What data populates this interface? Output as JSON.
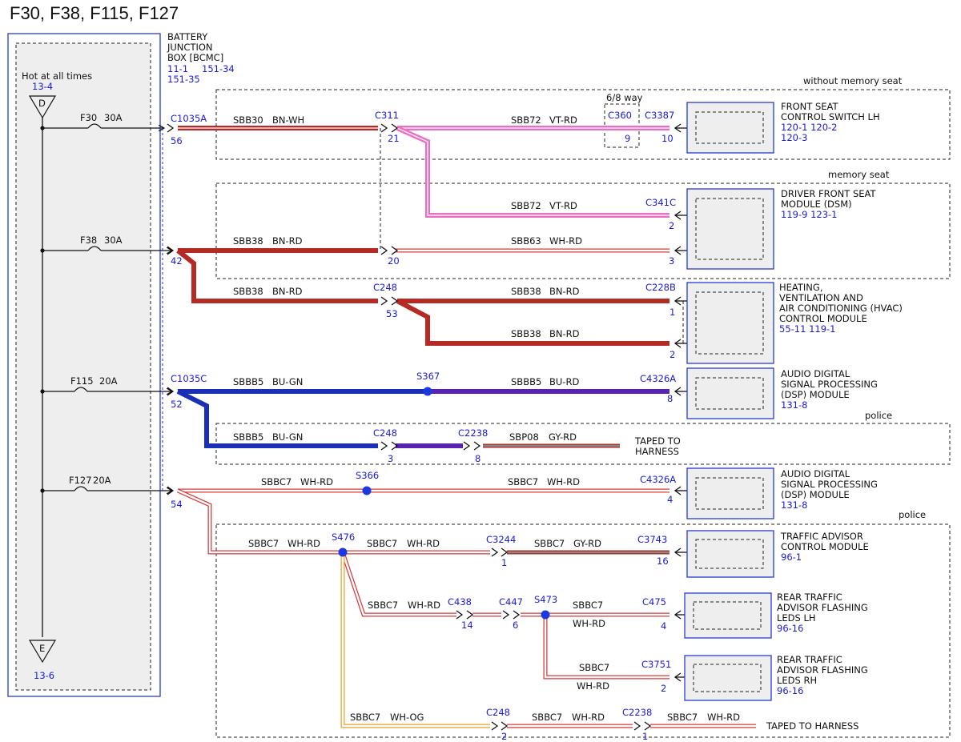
{
  "title": "F30, F38, F115, F127",
  "bjb": {
    "name": [
      "BATTERY",
      "JUNCTION",
      "BOX [BCMC]"
    ],
    "refs": [
      "11-1",
      "151-34",
      "151-35"
    ],
    "hot_label": "Hot at all times",
    "top_ref": "13-4",
    "top_letter": "D",
    "bottom_letter": "E",
    "bottom_ref": "13-6"
  },
  "fuses": [
    {
      "name": "F30",
      "rating": "30A"
    },
    {
      "name": "F38",
      "rating": "30A"
    },
    {
      "name": "F115",
      "rating": "20A"
    },
    {
      "name": "F127",
      "rating": "20A"
    }
  ],
  "regions": {
    "without_memory": "without memory seat",
    "memory": "memory seat",
    "police1": "police",
    "police2": "police",
    "way": "6/8 way"
  },
  "connectors": {
    "c1035a": {
      "name": "C1035A",
      "pin": "56"
    },
    "c311": {
      "name": "C311",
      "pin": "21",
      "pin2": "20"
    },
    "c360": {
      "name": "C360",
      "pin": "9"
    },
    "c3387": {
      "name": "C3387",
      "pin": "10"
    },
    "c341c": {
      "name": "C341C",
      "pin": "2",
      "pin2": "3"
    },
    "pin42": "42",
    "c248a": {
      "name": "C248",
      "pin": "53"
    },
    "c228b": {
      "name": "C228B",
      "pin": "1",
      "pin2": "2"
    },
    "c1035c": {
      "name": "C1035C",
      "pin": "52"
    },
    "s367": {
      "name": "S367"
    },
    "c4326a1": {
      "name": "C4326A",
      "pin": "8"
    },
    "c248b": {
      "name": "C248",
      "pin": "3"
    },
    "c2238a": {
      "name": "C2238",
      "pin": "8"
    },
    "pin54": "54",
    "s366": {
      "name": "S366"
    },
    "c4326a2": {
      "name": "C4326A",
      "pin": "4"
    },
    "s476": {
      "name": "S476"
    },
    "c3244": {
      "name": "C3244",
      "pin": "1"
    },
    "c3743": {
      "name": "C3743",
      "pin": "16"
    },
    "c438": {
      "name": "C438",
      "pin": "14"
    },
    "c447": {
      "name": "C447",
      "pin": "6"
    },
    "s473": {
      "name": "S473"
    },
    "c475": {
      "name": "C475",
      "pin": "4"
    },
    "c3751": {
      "name": "C3751",
      "pin": "2"
    },
    "c248c": {
      "name": "C248",
      "pin": "2"
    },
    "c2238b": {
      "name": "C2238",
      "pin": "1"
    }
  },
  "wires": {
    "w1a": {
      "circuit": "SBB30",
      "color": "BN-WH"
    },
    "w1b": {
      "circuit": "SBB72",
      "color": "VT-RD"
    },
    "w2": {
      "circuit": "SBB72",
      "color": "VT-RD"
    },
    "w3a": {
      "circuit": "SBB38",
      "color": "BN-RD"
    },
    "w3b": {
      "circuit": "SBB63",
      "color": "WH-RD"
    },
    "w4a": {
      "circuit": "SBB38",
      "color": "BN-RD"
    },
    "w4b": {
      "circuit": "SBB38",
      "color": "BN-RD"
    },
    "w5": {
      "circuit": "SBB38",
      "color": "BN-RD"
    },
    "w6a": {
      "circuit": "SBBB5",
      "color": "BU-GN"
    },
    "w6b": {
      "circuit": "SBBB5",
      "color": "BU-RD"
    },
    "w7a": {
      "circuit": "SBBB5",
      "color": "BU-GN"
    },
    "w7b": {
      "circuit": "SBP08",
      "color": "GY-RD"
    },
    "w8a": {
      "circuit": "SBBC7",
      "color": "WH-RD"
    },
    "w8b": {
      "circuit": "SBBC7",
      "color": "WH-RD"
    },
    "w9a": {
      "circuit": "SBBC7",
      "color": "WH-RD"
    },
    "w9b": {
      "circuit": "SBBC7",
      "color": "WH-RD"
    },
    "w9c": {
      "circuit": "SBBC7",
      "color": "GY-RD"
    },
    "w10a": {
      "circuit": "SBBC7",
      "color": "WH-RD"
    },
    "w10b": {
      "circuit": "SBBC7",
      "color": "WH-RD"
    },
    "w11": {
      "circuit": "SBBC7",
      "color": "WH-RD"
    },
    "w12a": {
      "circuit": "SBBC7",
      "color": "WH-OG"
    },
    "w12b": {
      "circuit": "SBBC7",
      "color": "WH-RD"
    },
    "w12c": {
      "circuit": "SBBC7",
      "color": "WH-RD"
    }
  },
  "taped1": [
    "TAPED TO",
    "HARNESS"
  ],
  "taped2": "TAPED TO HARNESS",
  "modules": {
    "m1": {
      "name": [
        "FRONT SEAT",
        "CONTROL SWITCH LH"
      ],
      "refs": [
        "120-1  120-2",
        "120-3"
      ]
    },
    "m2": {
      "name": [
        "DRIVER FRONT SEAT",
        "MODULE (DSM)"
      ],
      "refs": [
        "119-9  123-1"
      ]
    },
    "m3": {
      "name": [
        "HEATING,",
        "VENTILATION AND",
        "AIR CONDITIONING (HVAC)",
        "CONTROL MODULE"
      ],
      "refs": [
        "55-11  119-1"
      ]
    },
    "m4": {
      "name": [
        "AUDIO DIGITAL",
        "SIGNAL PROCESSING",
        "(DSP) MODULE"
      ],
      "refs": [
        "131-8"
      ]
    },
    "m5": {
      "name": [
        "AUDIO DIGITAL",
        "SIGNAL PROCESSING",
        "(DSP) MODULE"
      ],
      "refs": [
        "131-8"
      ]
    },
    "m6": {
      "name": [
        "TRAFFIC ADVISOR",
        "CONTROL MODULE"
      ],
      "refs": [
        "96-1"
      ]
    },
    "m7": {
      "name": [
        "REAR TRAFFIC",
        "ADVISOR FLASHING",
        "LEDS LH"
      ],
      "refs": [
        "96-16"
      ]
    },
    "m8": {
      "name": [
        "REAR TRAFFIC",
        "ADVISOR FLASHING",
        "LEDS RH"
      ],
      "refs": [
        "96-16"
      ]
    }
  },
  "colors": {
    "brown_red": "#b52a24",
    "violet": "#e870c0",
    "blue": "#1a2fb8",
    "white_red": "#d63a3a",
    "splice": "#1a3ae0",
    "module_border": "#2a3ad8",
    "bjb_border": "#2a3ad8"
  }
}
